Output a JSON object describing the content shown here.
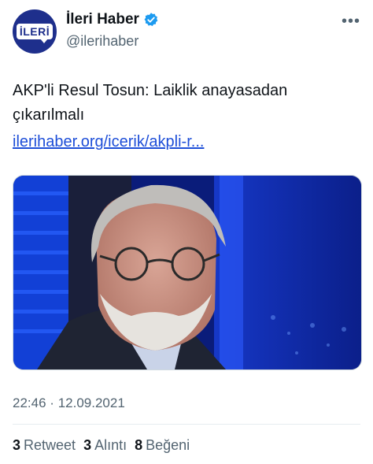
{
  "account": {
    "display_name": "İleri Haber",
    "handle": "@ilerihaber",
    "avatar_text": "İLERİ",
    "more_icon": "•••"
  },
  "tweet": {
    "text": "AKP'li Resul Tosun: Laiklik anayasadan çıkarılmalı",
    "link": "ilerihaber.org/icerik/akpli-r..."
  },
  "meta": {
    "time": "22:46",
    "separator": "·",
    "date": "12.09.2021"
  },
  "stats": {
    "retweets_count": "3",
    "retweets_label": "Retweet",
    "quotes_count": "3",
    "quotes_label": "Alıntı",
    "likes_count": "8",
    "likes_label": "Beğeni"
  },
  "colors": {
    "link": "#1d4ed8",
    "verified": "#1d9bf0",
    "avatar_bg": "#1e2f8c"
  }
}
